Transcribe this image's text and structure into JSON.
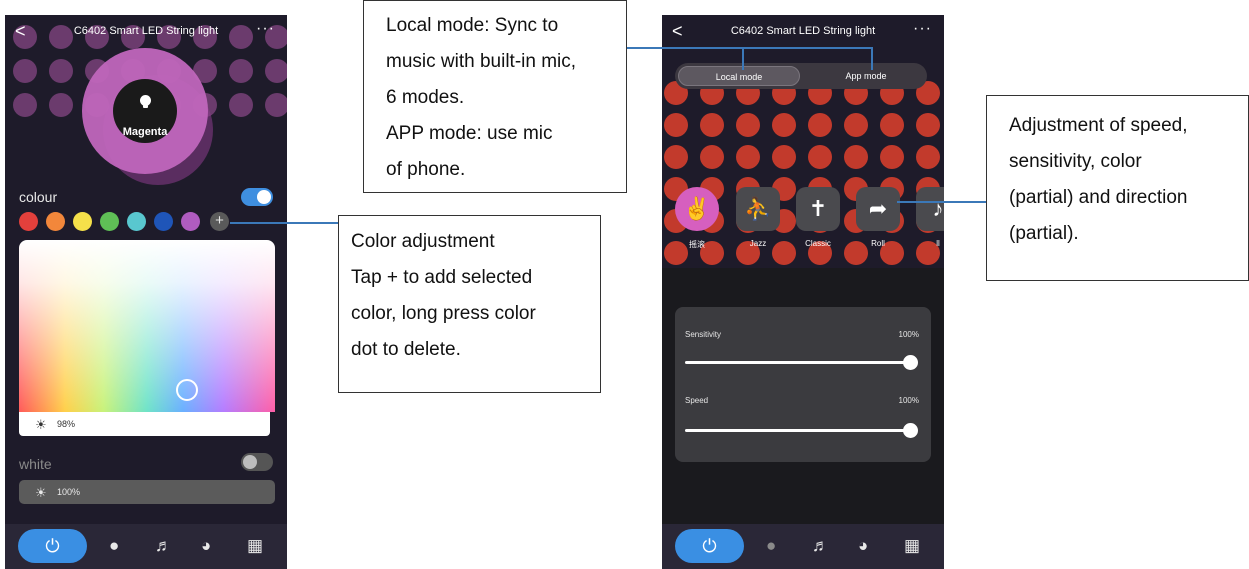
{
  "phone_left": {
    "title": "C6402 Smart LED String light",
    "back": "<",
    "more": "···",
    "selected_color_name": "Magenta",
    "colour_label": "colour",
    "colour_toggle_on": true,
    "swatches": [
      "#e3403c",
      "#f2873b",
      "#f5e04a",
      "#5fbf56",
      "#59c7cf",
      "#1f55b8",
      "#b05cc0"
    ],
    "add_label": "+",
    "brightness_value": "98%",
    "white_label": "white",
    "white_toggle_on": false,
    "white_brightness_value": "100%",
    "nav": {
      "power": "⏻",
      "bulb": "💡",
      "music": "▮▮",
      "palette": "🎨",
      "grid": "▦"
    }
  },
  "phone_right": {
    "title": "C6402 Smart LED String light",
    "back": "<",
    "more": "···",
    "mode_tabs": [
      "Local mode",
      "App mode"
    ],
    "modes": [
      {
        "label": "摇滚",
        "icon": "🤘"
      },
      {
        "label": "Jazz",
        "icon": "♫"
      },
      {
        "label": "Classic",
        "icon": "♪"
      },
      {
        "label": "Roll",
        "icon": "💪"
      },
      {
        "label": "ll",
        "icon": "♪"
      }
    ],
    "sensitivity_label": "Sensitivity",
    "sensitivity_value": "100%",
    "speed_label": "Speed",
    "speed_value": "100%"
  },
  "callouts": {
    "local": [
      "Local mode: Sync to",
      "music with built-in mic,",
      "6 modes.",
      "APP mode: use mic",
      "of phone."
    ],
    "color": [
      "Color adjustment",
      "Tap + to add selected",
      "color, long press color",
      "dot to delete."
    ],
    "adjust": [
      "Adjustment of speed,",
      "sensitivity, color",
      "(partial) and direction",
      "(partial)."
    ]
  },
  "accent_color": "#3a8fe3",
  "connector_color": "#3b78b8"
}
